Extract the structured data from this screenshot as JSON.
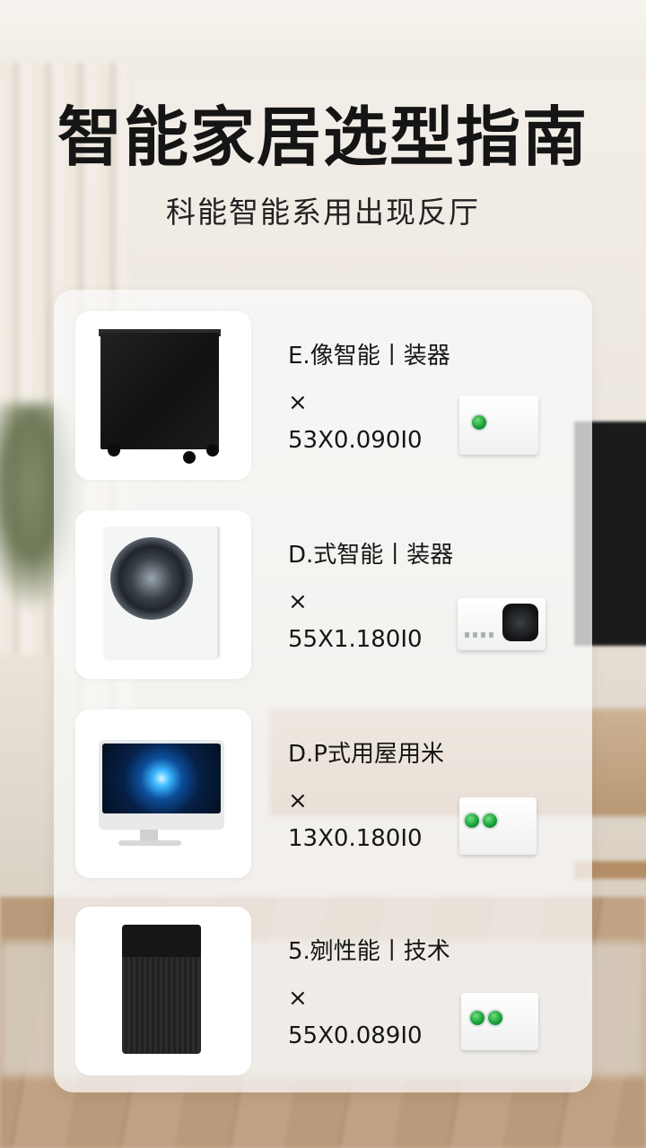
{
  "title": "智能家居选型指南",
  "subtitle": "科能智能系用出现反厅",
  "items": [
    {
      "name": "E.像智能丨装器",
      "times": "×",
      "spec": "53X0.090I0",
      "product_icon": "black-cabinet-icon",
      "device_icon": "white-device-green-led-icon"
    },
    {
      "name": "D.式智能丨装器",
      "times": "×",
      "spec": "55X1.180I0",
      "product_icon": "washing-machine-icon",
      "device_icon": "smart-hub-icon"
    },
    {
      "name": "D.P式用屋用米",
      "times": "×",
      "spec": "13X0.180I0",
      "product_icon": "monitor-icon",
      "device_icon": "white-device-two-leds-icon"
    },
    {
      "name": "5.剜性能丨技术",
      "times": "×",
      "spec": "55X0.089I0",
      "product_icon": "air-purifier-icon",
      "device_icon": "white-device-two-leds-icon"
    }
  ],
  "colors": {
    "title": "#151515",
    "led_green": "#1aa13a",
    "panel": "#fafaf9"
  }
}
